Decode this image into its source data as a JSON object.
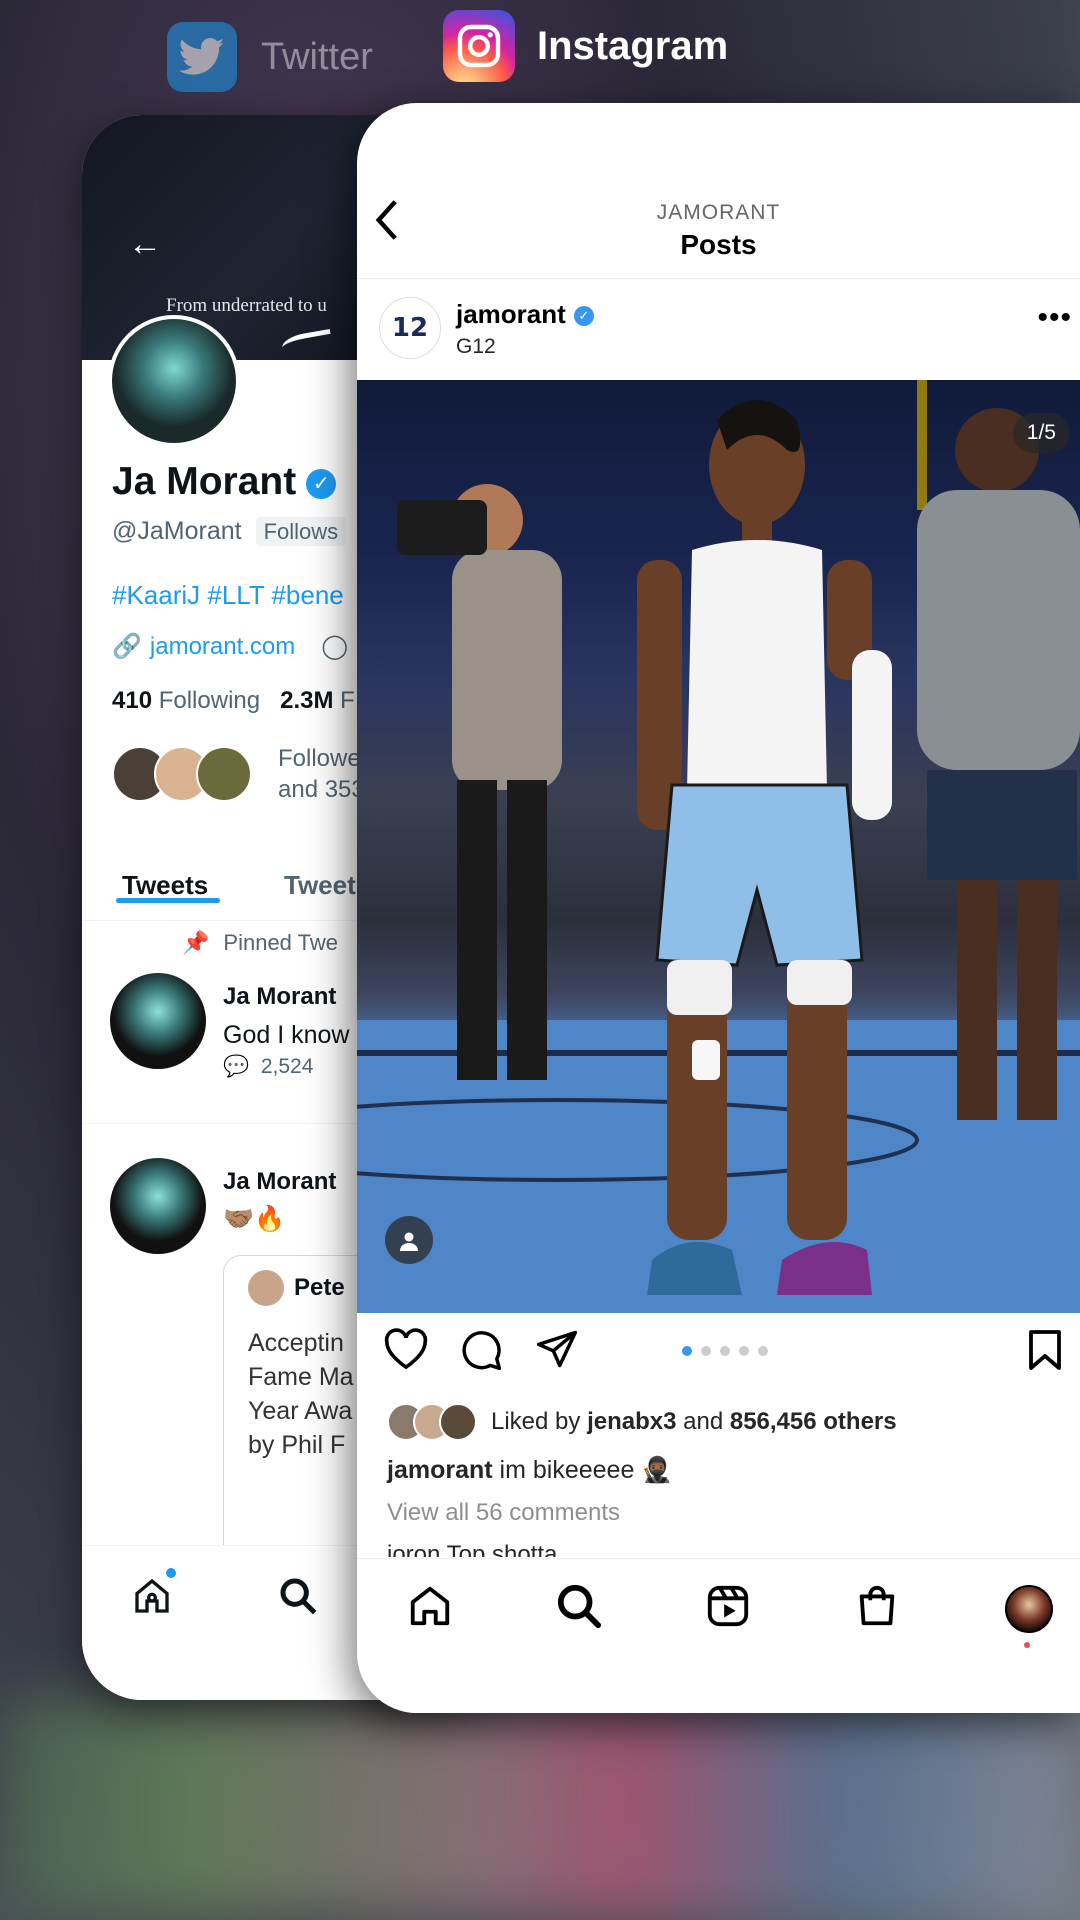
{
  "switcher": {
    "twitter_label": "Twitter",
    "instagram_label": "Instagram"
  },
  "twitter": {
    "banner_text": "From underrated to u",
    "name": "Ja Morant",
    "handle": "@JaMorant",
    "follows_badge": "Follows",
    "hashtags": "#KaariJ #LLT #bene",
    "website": "jamorant.com",
    "following_count": "410",
    "following_label": "Following",
    "followers_count": "2.3M",
    "followers_label": "F",
    "followed_by_line1": "Followe",
    "followed_by_line2": "and 353",
    "tab_tweets": "Tweets",
    "tab_replies": "Tweet",
    "pinned_label": "Pinned Twe",
    "tweet1": {
      "name": "Ja Morant",
      "text": "God I know",
      "reply_count": "2,524"
    },
    "tweet2": {
      "name": "Ja Morant",
      "text": "🤝🏽🔥",
      "quote_author": "Pete",
      "quote_text": "Acceptin\nFame Ma\nYear Awa\nby Phil F"
    },
    "nav": {
      "home_icon": "home-icon",
      "search_icon": "search-icon"
    },
    "colors": {
      "accent": "#1d9bf0"
    }
  },
  "instagram": {
    "header_sub": "JAMORANT",
    "header_title": "Posts",
    "post_avatar_text": "12",
    "username": "jamorant",
    "location": "G12",
    "image_counter": "1/5",
    "carousel": {
      "count": 5,
      "active": 0
    },
    "liked_by_prefix": "Liked by",
    "liked_by_user": "jenabx3",
    "liked_by_and": "and",
    "liked_by_others": "856,456 others",
    "caption_user": "jamorant",
    "caption_text": "im bikeeeee 🥷🏾",
    "view_comments": "View all 56 comments",
    "comment_peek": "joron Top shotta",
    "nav": {
      "home_icon": "home-icon",
      "search_icon": "search-icon",
      "reels_icon": "reels-icon",
      "shop_icon": "shop-icon",
      "profile_icon": "profile-avatar"
    },
    "colors": {
      "accent": "#3897f0",
      "notification": "#ed4956"
    }
  }
}
